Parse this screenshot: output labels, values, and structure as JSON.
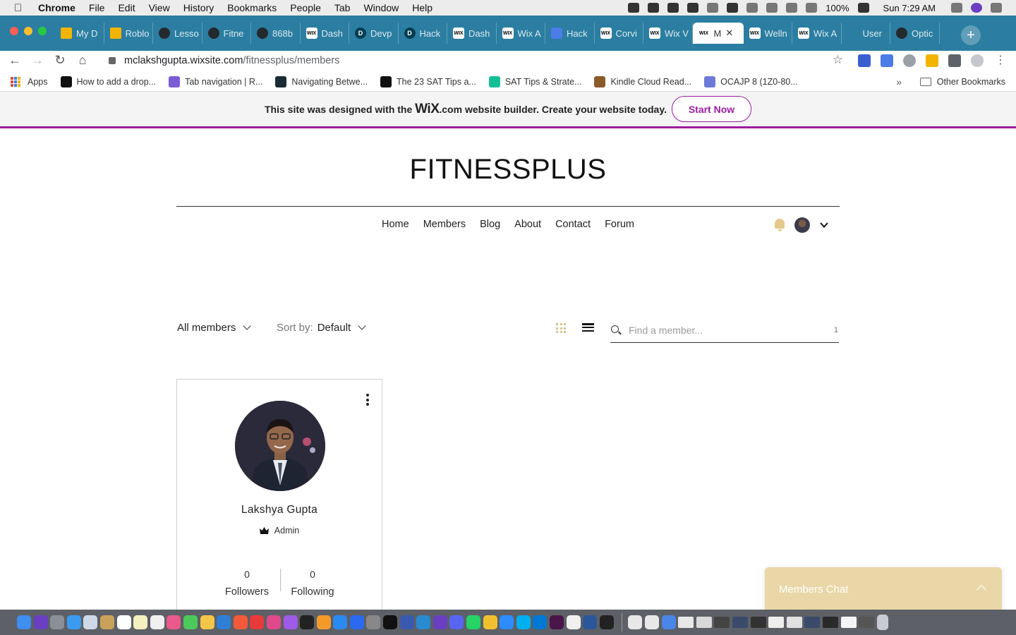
{
  "menubar": {
    "app_name": "Chrome",
    "items": [
      "File",
      "Edit",
      "View",
      "History",
      "Bookmarks",
      "People",
      "Tab",
      "Window",
      "Help"
    ],
    "battery": "100%",
    "clock": "Sun 7:29 AM"
  },
  "tabs": [
    {
      "label": "My D",
      "icon": "google-drive-icon"
    },
    {
      "label": "Roblo",
      "icon": "google-drive-icon"
    },
    {
      "label": "Lesso",
      "icon": "globe-icon"
    },
    {
      "label": "Fitne",
      "icon": "github-icon"
    },
    {
      "label": "868b",
      "icon": "globe-icon"
    },
    {
      "label": "Dash",
      "icon": "wix-icon"
    },
    {
      "label": "Devp",
      "icon": "devpost-icon"
    },
    {
      "label": "Hack",
      "icon": "devpost-icon"
    },
    {
      "label": "Dash",
      "icon": "wix-icon"
    },
    {
      "label": "Wix A",
      "icon": "wix-icon"
    },
    {
      "label": "Hack",
      "icon": "google-docs-icon"
    },
    {
      "label": "Corvi",
      "icon": "wix-icon"
    },
    {
      "label": "Wix V",
      "icon": "wix-icon"
    },
    {
      "label": "M",
      "icon": "wix-icon",
      "active": true
    },
    {
      "label": "Welln",
      "icon": "wix-icon"
    },
    {
      "label": "Wix A",
      "icon": "wix-icon"
    },
    {
      "label": "User",
      "icon": "blank-icon"
    },
    {
      "label": "Optic",
      "icon": "github-icon"
    }
  ],
  "address_bar": {
    "domain": "mclakshgupta.wixsite.com",
    "path": "/fitnessplus/members"
  },
  "bookmarks": {
    "apps_label": "Apps",
    "items": [
      {
        "label": "How to add a drop...",
        "icon": "medium-icon",
        "color": "#111111"
      },
      {
        "label": "Tab navigation | R...",
        "icon": "react-navigation-icon",
        "color": "#7b5cd6"
      },
      {
        "label": "Navigating Betwe...",
        "icon": "react-icon",
        "color": "#1b2b34"
      },
      {
        "label": "The 23 SAT Tips a...",
        "icon": "graduation-cap-icon",
        "color": "#111111"
      },
      {
        "label": "SAT Tips & Strate...",
        "icon": "khan-academy-icon",
        "color": "#14bf96"
      },
      {
        "label": "Kindle Cloud Read...",
        "icon": "kindle-icon",
        "color": "#8a5a2b"
      },
      {
        "label": "OCAJP 8 (1Z0-80...",
        "icon": "oracle-icon",
        "color": "#6f7ad8"
      }
    ],
    "more": "»",
    "other_label": "Other Bookmarks"
  },
  "wix_banner": {
    "prefix": "This site was designed with the",
    "logo": "WiX",
    "suffix": ".com website builder. Create your website today.",
    "cta": "Start Now"
  },
  "site": {
    "title": "FITNESSPLUS",
    "nav": [
      "Home",
      "Members",
      "Blog",
      "About",
      "Contact",
      "Forum"
    ]
  },
  "members": {
    "filter_label": "All members",
    "sort_prefix": "Sort by:",
    "sort_value": "Default",
    "search_placeholder": "Find a member...",
    "search_count": "1",
    "cards": [
      {
        "name": "Lakshya Gupta",
        "role": "Admin",
        "followers_count": "0",
        "followers_label": "Followers",
        "following_count": "0",
        "following_label": "Following"
      }
    ]
  },
  "chat": {
    "label": "Members Chat"
  },
  "colors": {
    "tabstrip": "#2b7ea1",
    "wix_accent": "#9b1d9e",
    "chat_bg": "#e9d7a7",
    "bell": "#e4c98b"
  }
}
